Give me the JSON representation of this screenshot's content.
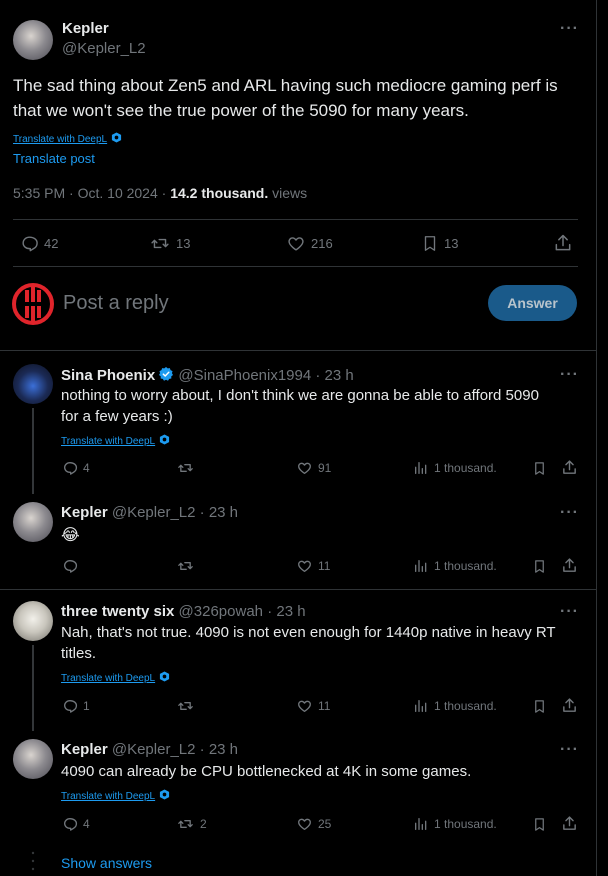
{
  "main_post": {
    "author": "Kepler",
    "handle": "@Kepler_L2",
    "text_line1": "The sad thing about Zen5 and ARL having such mediocre gaming perf is",
    "text_line2": "that we won't see the true power of the 5090 for many years.",
    "translate_deepl": "Translate with DeepL",
    "translate_post": "Translate post",
    "time": "5:35 PM",
    "date": "Oct. 10 2024",
    "views_count": "14.2 thousand.",
    "views_label": "views",
    "replies": "42",
    "reposts": "13",
    "likes": "216",
    "bookmarks": "13"
  },
  "reply_box": {
    "placeholder": "Post a reply",
    "button": "Answer"
  },
  "replies": [
    {
      "author": "Sina Phoenix",
      "handle": "@SinaPhoenix1994",
      "time": "23 h",
      "line1": "nothing to worry about, I don't think we are gonna be able to afford 5090",
      "line2": "for a few years :)",
      "translate": "Translate with DeepL",
      "replies": "4",
      "reposts": "",
      "likes": "91",
      "views": "1 thousand."
    },
    {
      "author": "Kepler",
      "handle": "@Kepler_L2",
      "time": "23 h",
      "line1": "😂",
      "replies": "",
      "reposts": "",
      "likes": "11",
      "views": "1 thousand."
    },
    {
      "author": "three twenty six",
      "handle": "@326powah",
      "time": "23 h",
      "line1": "Nah, that's not true. 4090 is not even enough for 1440p native in heavy RT",
      "line2": "titles.",
      "translate": "Translate with DeepL",
      "replies": "1",
      "reposts": "",
      "likes": "11",
      "views": "1 thousand."
    },
    {
      "author": "Kepler",
      "handle": "@Kepler_L2",
      "time": "23 h",
      "line1": "4090 can already be CPU bottlenecked at 4K in some games.",
      "translate": "Translate with DeepL",
      "replies": "4",
      "reposts": "2",
      "likes": "25",
      "views": "1 thousand."
    }
  ],
  "show_answers": "Show answers",
  "separator_dot": "·",
  "more_icon": "more-dots-icon",
  "colors": {
    "background": "#000000",
    "text": "#e7e9ea",
    "muted": "#71767b",
    "link": "#1d9bf0",
    "border": "#2f3336",
    "button": "#1a5a8a",
    "logo_red": "#e0242b"
  }
}
